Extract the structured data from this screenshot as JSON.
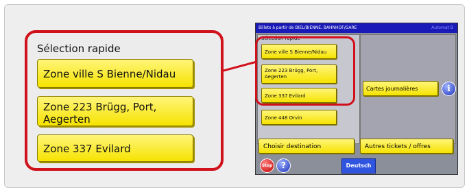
{
  "zoom": {
    "title": "Sélection rapide",
    "buttons": [
      "Zone ville S Bienne/Nidau",
      "Zone 223 Brügg, Port,\nAegerten",
      "Zone 337 Evilard"
    ]
  },
  "screen": {
    "header_title": "Billets à partir de BIEL/BIENNE, BAHNHOF/GARE",
    "header_mode": "Automat B",
    "quick_label": "Sélection rapide",
    "quick_buttons": [
      "Zone ville S Bienne/Nidau",
      "Zone 223 Brügg, Port, Aegerten",
      "Zone 337 Evilard",
      "Zone 448 Orvin"
    ],
    "cartes_label": "Cartes journalières",
    "info_icon": "i",
    "choisir_label": "Choisir destination",
    "autres_label": "Autres tickets / offres",
    "stop_label": "Stop",
    "help_icon": "?",
    "language_label": "Deutsch"
  },
  "colors": {
    "highlight": "#d0101a",
    "button_yellow": "#f6e300",
    "header_blue": "#1a1ab8"
  }
}
